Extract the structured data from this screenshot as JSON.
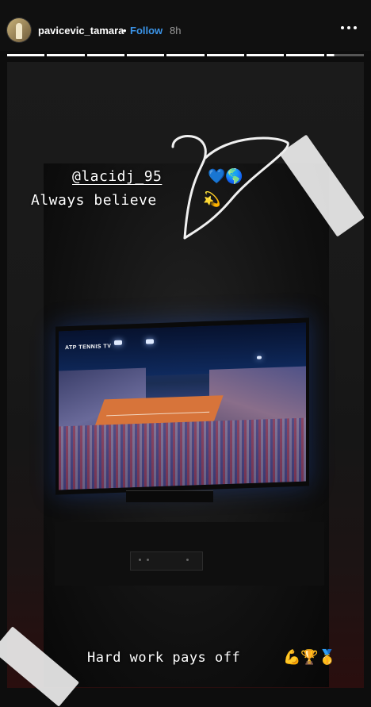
{
  "header": {
    "username": "pavicevic_tamara",
    "dot": "•",
    "follow_label": "Follow",
    "age": "8h",
    "more_icon": "more-horizontal-icon"
  },
  "progress": {
    "segments_total": 9,
    "active_segment": 9,
    "active_fraction": 0.2
  },
  "story": {
    "mention": "@lacidj_95",
    "mention_emoji": "💙🌎",
    "tagline": "Always believe",
    "tagline_emoji": "💫",
    "bottom_text": "Hard work pays off",
    "bottom_emoji": "💪🏆🥇",
    "screen_logo": "ATP TENNIS TV"
  },
  "colors": {
    "follow": "#3b94e8",
    "text": "#ffffff",
    "muted": "#9a9a9a"
  }
}
